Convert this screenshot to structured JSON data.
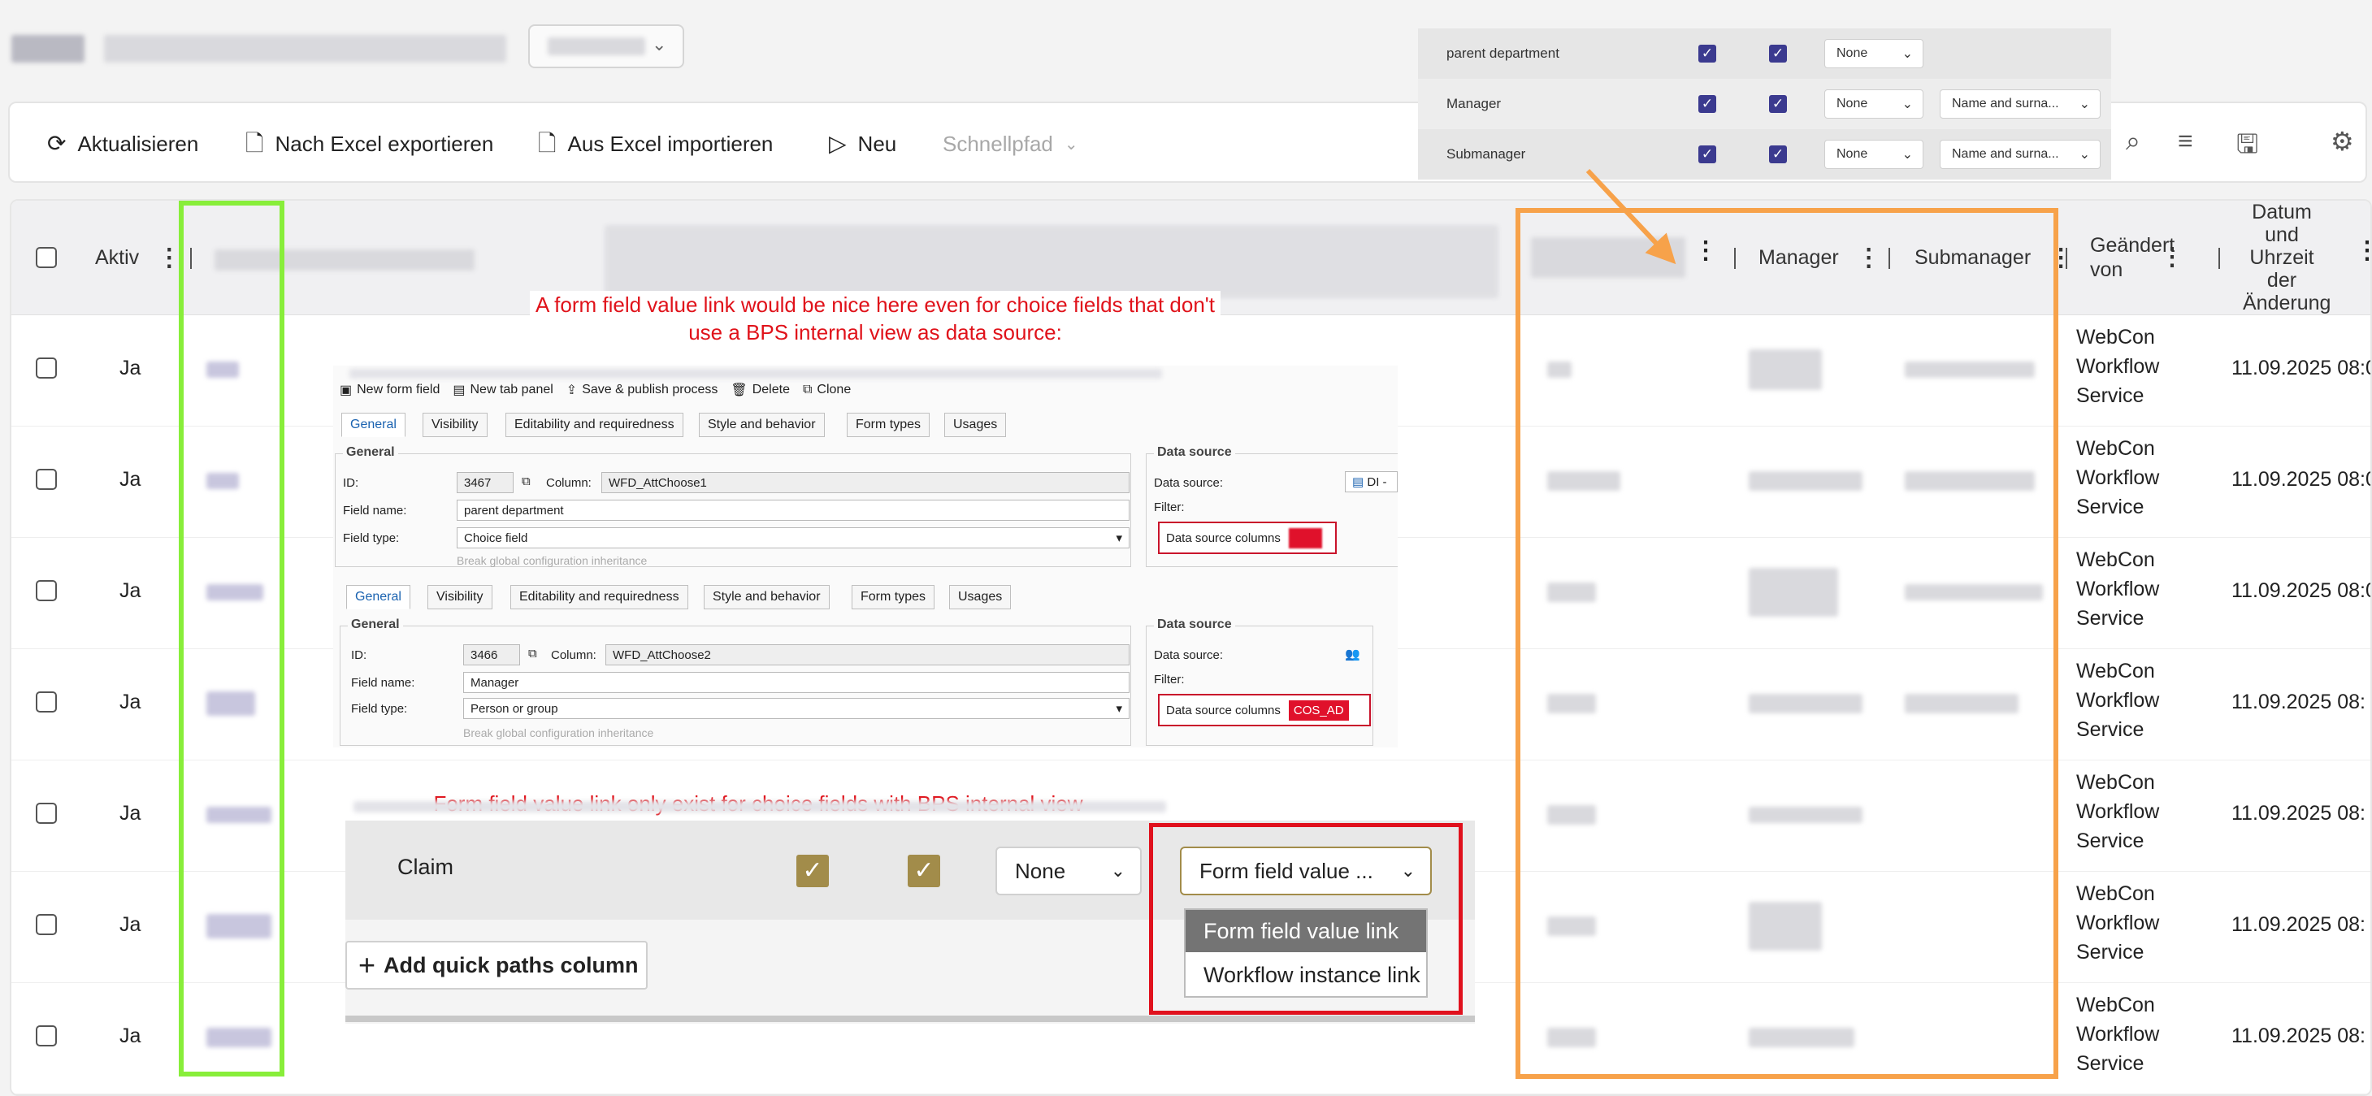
{
  "toolbar": {
    "refresh": "Aktualisieren",
    "export_excel": "Nach Excel exportieren",
    "import_excel": "Aus Excel importieren",
    "new": "Neu",
    "quick_path": "Schnellpfad"
  },
  "grid": {
    "columns": {
      "active": "Aktiv",
      "manager": "Manager",
      "submanager": "Submanager",
      "changed_by": "Geändert von",
      "changed_date": "Datum und Uhrzeit der Änderung"
    },
    "rows": [
      {
        "active": "Ja",
        "changed_by": "WebCon Workflow Service",
        "date": "11.09.2025 08:0"
      },
      {
        "active": "Ja",
        "changed_by": "WebCon Workflow Service",
        "date": "11.09.2025 08:0"
      },
      {
        "active": "Ja",
        "changed_by": "WebCon Workflow Service",
        "date": "11.09.2025 08:0"
      },
      {
        "active": "Ja",
        "changed_by": "WebCon Workflow Service",
        "date": "11.09.2025 08:"
      },
      {
        "active": "Ja",
        "changed_by": "WebCon Workflow Service",
        "date": "11.09.2025 08:"
      },
      {
        "active": "Ja",
        "changed_by": "WebCon Workflow Service",
        "date": "11.09.2025 08:"
      },
      {
        "active": "Ja",
        "changed_by": "WebCon Workflow Service",
        "date": "11.09.2025 08:"
      }
    ]
  },
  "config_panel": {
    "rows": [
      {
        "label": "parent department",
        "select1": "None",
        "select2": ""
      },
      {
        "label": "Manager",
        "select1": "None",
        "select2": "Name and surna..."
      },
      {
        "label": "Submanager",
        "select1": "None",
        "select2": "Name and surna..."
      }
    ]
  },
  "notes": {
    "top": "A form field value link would be nice here even for choice fields that don't use a BPS internal view as data source:",
    "bottom": "Form field value link only exist for choice fields with BPS internal view"
  },
  "designer": {
    "toolbar": {
      "new_form_field": "New form field",
      "new_tab_panel": "New tab panel",
      "save_publish": "Save & publish process",
      "delete": "Delete",
      "clone": "Clone"
    },
    "tabs": [
      "General",
      "Visibility",
      "Editability and requiredness",
      "Style and behavior",
      "Form types",
      "Usages"
    ],
    "group_general": "General",
    "group_datasource": "Data source",
    "label_id": "ID:",
    "label_column": "Column:",
    "label_field_name": "Field name:",
    "label_field_type": "Field type:",
    "label_break": "Break global configuration inheritance",
    "label_data_source": "Data source:",
    "label_filter": "Filter:",
    "label_ds_columns": "Data source columns",
    "field1": {
      "id": "3467",
      "column": "WFD_AttChoose1",
      "name": "parent department",
      "type": "Choice field",
      "source": "DI -"
    },
    "field2": {
      "id": "3466",
      "column": "WFD_AttChoose2",
      "name": "Manager",
      "type": "Person or group",
      "ds_badge": "COS_AD"
    }
  },
  "quick_path": {
    "claim_label": "Claim",
    "select_none": "None",
    "select_link": "Form field value ...",
    "add_button": "Add quick paths column",
    "options": [
      "Form field value link",
      "Workflow instance link"
    ]
  }
}
